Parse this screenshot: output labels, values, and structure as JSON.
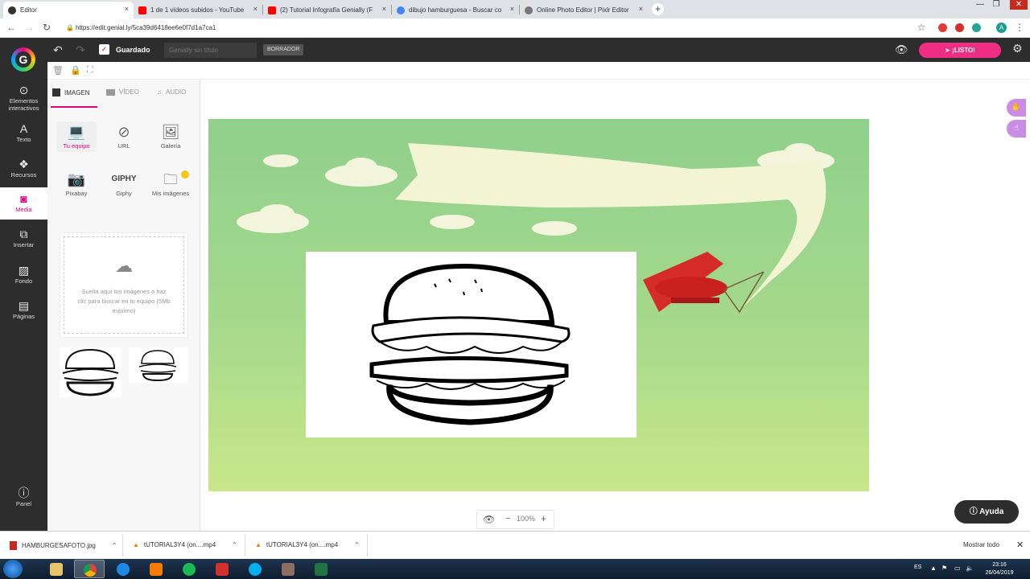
{
  "browser": {
    "tabs": [
      {
        "label": "Editor",
        "favicon_color": "#333333"
      },
      {
        "label": "1 de 1 vídeos subidos - YouTube",
        "favicon_color": "#ff0000"
      },
      {
        "label": "(2) Tutorial Infografía Genially (F",
        "favicon_color": "#ff0000"
      },
      {
        "label": "dibujo hamburguesa - Buscar co",
        "favicon_color": "#4285f4"
      },
      {
        "label": "Online Photo Editor | Pixlr Editor",
        "favicon_color": "#555555"
      }
    ],
    "close_glyph": "×",
    "new_tab_glyph": "+",
    "url": "https://edit.genial.ly/5ca39d6418ee6e0f7d1a7ca1",
    "avatar_letter": "A"
  },
  "genially": {
    "logo_letter": "G",
    "saved_label": "Guardado",
    "title_placeholder": "Genially sin título",
    "draft_badge": "BORRADOR",
    "ready_label": "¡LISTO!",
    "accent_color": "#ef2e83"
  },
  "sidebar": {
    "items": [
      {
        "label": "Elementos interactivos",
        "icon": "pointer-icon"
      },
      {
        "label": "Texto",
        "icon": "text-icon"
      },
      {
        "label": "Recursos",
        "icon": "resources-icon"
      },
      {
        "label": "Media",
        "icon": "camera-icon"
      },
      {
        "label": "Insertar",
        "icon": "insert-icon"
      },
      {
        "label": "Fondo",
        "icon": "background-icon"
      },
      {
        "label": "Páginas",
        "icon": "pages-icon"
      }
    ],
    "active": "Media",
    "panel_label": "Panel"
  },
  "media_panel": {
    "tabs": [
      "IMAGEN",
      "VÍDEO",
      "AUDIO"
    ],
    "sources": [
      {
        "label": "Tu equipo",
        "icon": "laptop-icon"
      },
      {
        "label": "URL",
        "icon": "link-icon"
      },
      {
        "label": "Galería",
        "icon": "gallery-icon"
      },
      {
        "label": "Pixabay",
        "icon": "camera-icon"
      },
      {
        "label": "Giphy",
        "icon": "giphy-logo"
      },
      {
        "label": "Mis imágenes",
        "icon": "folder-icon"
      }
    ],
    "giphy_text": "GIPHY",
    "drop_text": "Suelta aquí tus imágenes o haz clic para buscar en tu equipo (5Mb máximo)"
  },
  "zoom": {
    "value": "100%"
  },
  "help_label": "Ayuda",
  "downloads": {
    "items": [
      {
        "name": "HAMBURGESAFOTO.jpg"
      },
      {
        "name": "tUTORIAL3Y4 (on....mp4"
      },
      {
        "name": "tUTORIAL3Y4 (on....mp4"
      }
    ],
    "show_all": "Mostrar todo"
  },
  "taskbar": {
    "lang": "ES",
    "time": "23:16",
    "date": "26/04/2019"
  }
}
